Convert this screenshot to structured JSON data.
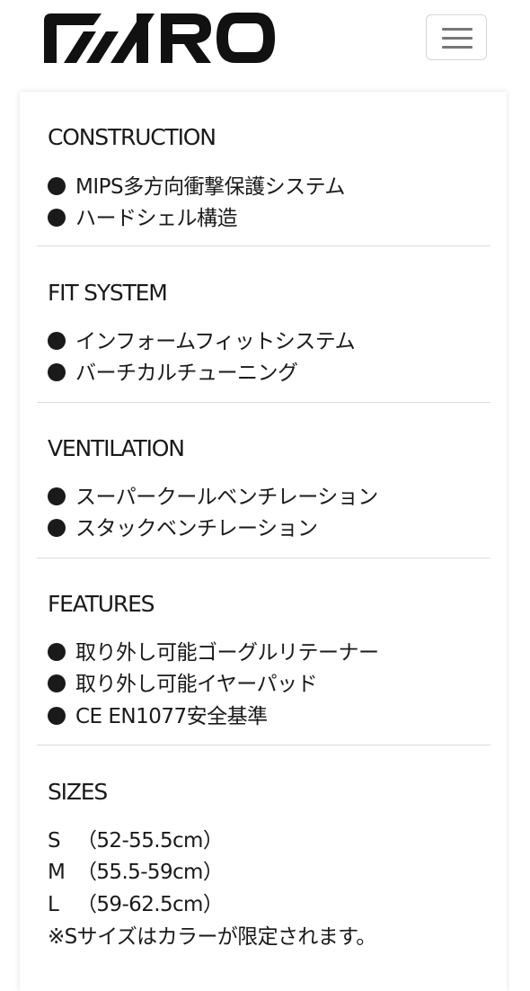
{
  "header": {
    "brand": "GIRO",
    "menu_icon": "hamburger-menu-icon"
  },
  "colors": {
    "text": "#1a1a1a",
    "divider": "#dcdcdc",
    "toggle_bar": "#777777"
  },
  "sections": [
    {
      "title": "CONSTRUCTION",
      "items": [
        "MIPS多方向衝撃保護システム",
        "ハードシェル構造"
      ]
    },
    {
      "title": "FIT SYSTEM",
      "items": [
        "インフォームフィットシステム",
        "バーチカルチューニング"
      ]
    },
    {
      "title": "VENTILATION",
      "items": [
        "スーパークールベンチレーション",
        "スタックベンチレーション"
      ]
    },
    {
      "title": "FEATURES",
      "items": [
        "取り外し可能ゴーグルリテーナー",
        "取り外し可能イヤーパッド",
        "CE EN1077安全基準"
      ]
    }
  ],
  "sizes": {
    "title": "SIZES",
    "rows": [
      {
        "size": "S",
        "range": "（52-55.5cm）"
      },
      {
        "size": "M",
        "range": "（55.5-59cm）"
      },
      {
        "size": "L",
        "range": "（59-62.5cm）"
      }
    ],
    "note": "※Sサイズはカラーが限定されます。"
  }
}
